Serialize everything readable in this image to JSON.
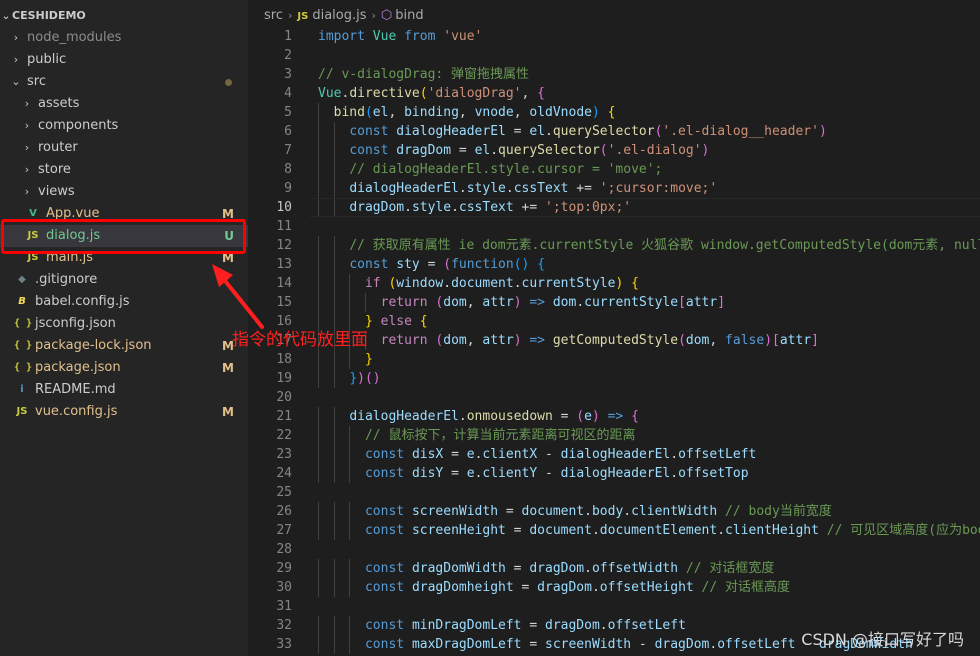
{
  "explorer": {
    "project_name": "CESHIDEMO",
    "items": [
      {
        "name": "node_modules",
        "kind": "folder",
        "depth": 0,
        "expanded": false,
        "color": "gray",
        "status": ""
      },
      {
        "name": "public",
        "kind": "folder",
        "depth": 0,
        "expanded": false,
        "color": "normal",
        "status": ""
      },
      {
        "name": "src",
        "kind": "folder",
        "depth": 0,
        "expanded": true,
        "color": "normal",
        "status": "dot"
      },
      {
        "name": "assets",
        "kind": "folder",
        "depth": 1,
        "expanded": false,
        "color": "normal",
        "status": ""
      },
      {
        "name": "components",
        "kind": "folder",
        "depth": 1,
        "expanded": false,
        "color": "normal",
        "status": ""
      },
      {
        "name": "router",
        "kind": "folder",
        "depth": 1,
        "expanded": false,
        "color": "normal",
        "status": ""
      },
      {
        "name": "store",
        "kind": "folder",
        "depth": 1,
        "expanded": false,
        "color": "normal",
        "status": ""
      },
      {
        "name": "views",
        "kind": "folder",
        "depth": 1,
        "expanded": false,
        "color": "normal",
        "status": ""
      },
      {
        "name": "App.vue",
        "kind": "vue",
        "depth": 1,
        "color": "modified",
        "status": "M"
      },
      {
        "name": "dialog.js",
        "kind": "js",
        "depth": 1,
        "color": "untracked",
        "status": "U",
        "selected": true
      },
      {
        "name": "main.js",
        "kind": "js",
        "depth": 1,
        "color": "modified",
        "status": "M"
      },
      {
        "name": ".gitignore",
        "kind": "git",
        "depth": 0,
        "color": "normal",
        "status": ""
      },
      {
        "name": "babel.config.js",
        "kind": "babel",
        "depth": 0,
        "color": "normal",
        "status": ""
      },
      {
        "name": "jsconfig.json",
        "kind": "json",
        "depth": 0,
        "color": "normal",
        "status": ""
      },
      {
        "name": "package-lock.json",
        "kind": "json",
        "depth": 0,
        "color": "modified",
        "status": "M"
      },
      {
        "name": "package.json",
        "kind": "json",
        "depth": 0,
        "color": "modified",
        "status": "M"
      },
      {
        "name": "README.md",
        "kind": "info",
        "depth": 0,
        "color": "normal",
        "status": ""
      },
      {
        "name": "vue.config.js",
        "kind": "js",
        "depth": 0,
        "color": "modified",
        "status": "M"
      }
    ]
  },
  "icons": {
    "js": "JS",
    "json": "{ }",
    "vue": "V",
    "git": "◆",
    "babel": "B",
    "info": "i",
    "chevron_right": "›",
    "chevron_down": "⌄",
    "symbol_method": "⬡"
  },
  "breadcrumb": {
    "folder": "src",
    "file": "dialog.js",
    "symbol": "bind"
  },
  "editor": {
    "current_line": 10,
    "lines": [
      {
        "n": 1,
        "indent": 0,
        "t": [
          [
            "k",
            "import"
          ],
          [
            "p",
            " "
          ],
          [
            "t",
            "Vue"
          ],
          [
            "p",
            " "
          ],
          [
            "k",
            "from"
          ],
          [
            "p",
            " "
          ],
          [
            "s",
            "'vue'"
          ]
        ]
      },
      {
        "n": 2,
        "indent": 0,
        "t": []
      },
      {
        "n": 3,
        "indent": 0,
        "t": [
          [
            "cm",
            "// v-dialogDrag: 弹窗拖拽属性"
          ]
        ]
      },
      {
        "n": 4,
        "indent": 0,
        "t": [
          [
            "t",
            "Vue"
          ],
          [
            "p",
            "."
          ],
          [
            "f",
            "directive"
          ],
          [
            "b1",
            "("
          ],
          [
            "s",
            "'dialogDrag'"
          ],
          [
            "p",
            ", "
          ],
          [
            "b2",
            "{"
          ]
        ]
      },
      {
        "n": 5,
        "indent": 1,
        "t": [
          [
            "f",
            "bind"
          ],
          [
            "b3",
            "("
          ],
          [
            "v",
            "el"
          ],
          [
            "p",
            ", "
          ],
          [
            "v",
            "binding"
          ],
          [
            "p",
            ", "
          ],
          [
            "v",
            "vnode"
          ],
          [
            "p",
            ", "
          ],
          [
            "v",
            "oldVnode"
          ],
          [
            "b3",
            ")"
          ],
          [
            "p",
            " "
          ],
          [
            "b1",
            "{"
          ]
        ]
      },
      {
        "n": 6,
        "indent": 2,
        "t": [
          [
            "k",
            "const"
          ],
          [
            "p",
            " "
          ],
          [
            "v",
            "dialogHeaderEl"
          ],
          [
            "p",
            " = "
          ],
          [
            "v",
            "el"
          ],
          [
            "p",
            "."
          ],
          [
            "f",
            "querySelector"
          ],
          [
            "b2",
            "("
          ],
          [
            "s",
            "'.el-dialog__header'"
          ],
          [
            "b2",
            ")"
          ]
        ]
      },
      {
        "n": 7,
        "indent": 2,
        "t": [
          [
            "k",
            "const"
          ],
          [
            "p",
            " "
          ],
          [
            "v",
            "dragDom"
          ],
          [
            "p",
            " = "
          ],
          [
            "v",
            "el"
          ],
          [
            "p",
            "."
          ],
          [
            "f",
            "querySelector"
          ],
          [
            "b2",
            "("
          ],
          [
            "s",
            "'.el-dialog'"
          ],
          [
            "b2",
            ")"
          ]
        ]
      },
      {
        "n": 8,
        "indent": 2,
        "t": [
          [
            "cm",
            "// dialogHeaderEl.style.cursor = 'move';"
          ]
        ]
      },
      {
        "n": 9,
        "indent": 2,
        "t": [
          [
            "v",
            "dialogHeaderEl"
          ],
          [
            "p",
            "."
          ],
          [
            "v",
            "style"
          ],
          [
            "p",
            "."
          ],
          [
            "v",
            "cssText"
          ],
          [
            "p",
            " += "
          ],
          [
            "s",
            "';cursor:move;'"
          ]
        ]
      },
      {
        "n": 10,
        "indent": 2,
        "t": [
          [
            "v",
            "dragDom"
          ],
          [
            "p",
            "."
          ],
          [
            "v",
            "style"
          ],
          [
            "p",
            "."
          ],
          [
            "v",
            "cssText"
          ],
          [
            "p",
            " += "
          ],
          [
            "s",
            "';top:0px;'"
          ]
        ]
      },
      {
        "n": 11,
        "indent": 0,
        "t": []
      },
      {
        "n": 12,
        "indent": 2,
        "t": [
          [
            "cm",
            "// 获取原有属性 ie dom元素.currentStyle 火狐谷歌 window.getComputedStyle(dom元素, null);"
          ]
        ]
      },
      {
        "n": 13,
        "indent": 2,
        "t": [
          [
            "k",
            "const"
          ],
          [
            "p",
            " "
          ],
          [
            "v",
            "sty"
          ],
          [
            "p",
            " = "
          ],
          [
            "b2",
            "("
          ],
          [
            "k",
            "function"
          ],
          [
            "b3",
            "("
          ],
          [
            "b3",
            ")"
          ],
          [
            "p",
            " "
          ],
          [
            "b3",
            "{"
          ]
        ]
      },
      {
        "n": 14,
        "indent": 3,
        "t": [
          [
            "c",
            "if"
          ],
          [
            "p",
            " "
          ],
          [
            "b1",
            "("
          ],
          [
            "v",
            "window"
          ],
          [
            "p",
            "."
          ],
          [
            "v",
            "document"
          ],
          [
            "p",
            "."
          ],
          [
            "v",
            "currentStyle"
          ],
          [
            "b1",
            ")"
          ],
          [
            "p",
            " "
          ],
          [
            "b1",
            "{"
          ]
        ]
      },
      {
        "n": 15,
        "indent": 4,
        "t": [
          [
            "c",
            "return"
          ],
          [
            "p",
            " "
          ],
          [
            "b2",
            "("
          ],
          [
            "v",
            "dom"
          ],
          [
            "p",
            ", "
          ],
          [
            "v",
            "attr"
          ],
          [
            "b2",
            ")"
          ],
          [
            "p",
            " "
          ],
          [
            "k",
            "=>"
          ],
          [
            "p",
            " "
          ],
          [
            "v",
            "dom"
          ],
          [
            "p",
            "."
          ],
          [
            "v",
            "currentStyle"
          ],
          [
            "b2",
            "["
          ],
          [
            "v",
            "attr"
          ],
          [
            "b2",
            "]"
          ]
        ]
      },
      {
        "n": 16,
        "indent": 3,
        "t": [
          [
            "b1",
            "}"
          ],
          [
            "p",
            " "
          ],
          [
            "c",
            "else"
          ],
          [
            "p",
            " "
          ],
          [
            "b1",
            "{"
          ]
        ]
      },
      {
        "n": 17,
        "indent": 4,
        "t": [
          [
            "c",
            "return"
          ],
          [
            "p",
            " "
          ],
          [
            "b2",
            "("
          ],
          [
            "v",
            "dom"
          ],
          [
            "p",
            ", "
          ],
          [
            "v",
            "attr"
          ],
          [
            "b2",
            ")"
          ],
          [
            "p",
            " "
          ],
          [
            "k",
            "=>"
          ],
          [
            "p",
            " "
          ],
          [
            "f",
            "getComputedStyle"
          ],
          [
            "b2",
            "("
          ],
          [
            "v",
            "dom"
          ],
          [
            "p",
            ", "
          ],
          [
            "k",
            "false"
          ],
          [
            "b2",
            ")"
          ],
          [
            "b2",
            "["
          ],
          [
            "v",
            "attr"
          ],
          [
            "b2",
            "]"
          ]
        ]
      },
      {
        "n": 18,
        "indent": 3,
        "t": [
          [
            "b1",
            "}"
          ]
        ]
      },
      {
        "n": 19,
        "indent": 2,
        "t": [
          [
            "b3",
            "}"
          ],
          [
            "b2",
            ")"
          ],
          [
            "b2",
            "("
          ],
          [
            "b2",
            ")"
          ]
        ]
      },
      {
        "n": 20,
        "indent": 0,
        "t": []
      },
      {
        "n": 21,
        "indent": 2,
        "t": [
          [
            "v",
            "dialogHeaderEl"
          ],
          [
            "p",
            "."
          ],
          [
            "f",
            "onmousedown"
          ],
          [
            "p",
            " = "
          ],
          [
            "b2",
            "("
          ],
          [
            "v",
            "e"
          ],
          [
            "b2",
            ")"
          ],
          [
            "p",
            " "
          ],
          [
            "k",
            "=>"
          ],
          [
            "p",
            " "
          ],
          [
            "b2",
            "{"
          ]
        ]
      },
      {
        "n": 22,
        "indent": 3,
        "t": [
          [
            "cm",
            "// 鼠标按下，计算当前元素距离可视区的距离"
          ]
        ]
      },
      {
        "n": 23,
        "indent": 3,
        "t": [
          [
            "k",
            "const"
          ],
          [
            "p",
            " "
          ],
          [
            "v",
            "disX"
          ],
          [
            "p",
            " = "
          ],
          [
            "v",
            "e"
          ],
          [
            "p",
            "."
          ],
          [
            "v",
            "clientX"
          ],
          [
            "p",
            " - "
          ],
          [
            "v",
            "dialogHeaderEl"
          ],
          [
            "p",
            "."
          ],
          [
            "v",
            "offsetLeft"
          ]
        ]
      },
      {
        "n": 24,
        "indent": 3,
        "t": [
          [
            "k",
            "const"
          ],
          [
            "p",
            " "
          ],
          [
            "v",
            "disY"
          ],
          [
            "p",
            " = "
          ],
          [
            "v",
            "e"
          ],
          [
            "p",
            "."
          ],
          [
            "v",
            "clientY"
          ],
          [
            "p",
            " - "
          ],
          [
            "v",
            "dialogHeaderEl"
          ],
          [
            "p",
            "."
          ],
          [
            "v",
            "offsetTop"
          ]
        ]
      },
      {
        "n": 25,
        "indent": 0,
        "t": []
      },
      {
        "n": 26,
        "indent": 3,
        "t": [
          [
            "k",
            "const"
          ],
          [
            "p",
            " "
          ],
          [
            "v",
            "screenWidth"
          ],
          [
            "p",
            " = "
          ],
          [
            "v",
            "document"
          ],
          [
            "p",
            "."
          ],
          [
            "v",
            "body"
          ],
          [
            "p",
            "."
          ],
          [
            "v",
            "clientWidth"
          ],
          [
            "p",
            " "
          ],
          [
            "cm",
            "// body当前宽度"
          ]
        ]
      },
      {
        "n": 27,
        "indent": 3,
        "t": [
          [
            "k",
            "const"
          ],
          [
            "p",
            " "
          ],
          [
            "v",
            "screenHeight"
          ],
          [
            "p",
            " = "
          ],
          [
            "v",
            "document"
          ],
          [
            "p",
            "."
          ],
          [
            "v",
            "documentElement"
          ],
          [
            "p",
            "."
          ],
          [
            "v",
            "clientHeight"
          ],
          [
            "p",
            " "
          ],
          [
            "cm",
            "// 可见区域高度(应为body"
          ]
        ]
      },
      {
        "n": 28,
        "indent": 0,
        "t": []
      },
      {
        "n": 29,
        "indent": 3,
        "t": [
          [
            "k",
            "const"
          ],
          [
            "p",
            " "
          ],
          [
            "v",
            "dragDomWidth"
          ],
          [
            "p",
            " = "
          ],
          [
            "v",
            "dragDom"
          ],
          [
            "p",
            "."
          ],
          [
            "v",
            "offsetWidth"
          ],
          [
            "p",
            " "
          ],
          [
            "cm",
            "// 对话框宽度"
          ]
        ]
      },
      {
        "n": 30,
        "indent": 3,
        "t": [
          [
            "k",
            "const"
          ],
          [
            "p",
            " "
          ],
          [
            "v",
            "dragDomheight"
          ],
          [
            "p",
            " = "
          ],
          [
            "v",
            "dragDom"
          ],
          [
            "p",
            "."
          ],
          [
            "v",
            "offsetHeight"
          ],
          [
            "p",
            " "
          ],
          [
            "cm",
            "// 对话框高度"
          ]
        ]
      },
      {
        "n": 31,
        "indent": 0,
        "t": []
      },
      {
        "n": 32,
        "indent": 3,
        "t": [
          [
            "k",
            "const"
          ],
          [
            "p",
            " "
          ],
          [
            "v",
            "minDragDomLeft"
          ],
          [
            "p",
            " = "
          ],
          [
            "v",
            "dragDom"
          ],
          [
            "p",
            "."
          ],
          [
            "v",
            "offsetLeft"
          ]
        ]
      },
      {
        "n": 33,
        "indent": 3,
        "t": [
          [
            "k",
            "const"
          ],
          [
            "p",
            " "
          ],
          [
            "v",
            "maxDragDomLeft"
          ],
          [
            "p",
            " = "
          ],
          [
            "v",
            "screenWidth"
          ],
          [
            "p",
            " - "
          ],
          [
            "v",
            "dragDom"
          ],
          [
            "p",
            "."
          ],
          [
            "v",
            "offsetLeft"
          ],
          [
            "p",
            " - "
          ],
          [
            "v",
            "dragDomWidth"
          ]
        ]
      }
    ]
  },
  "annotation": {
    "text": "指令的代码放里面"
  },
  "watermark": {
    "text": "CSDN @接口写好了吗"
  }
}
